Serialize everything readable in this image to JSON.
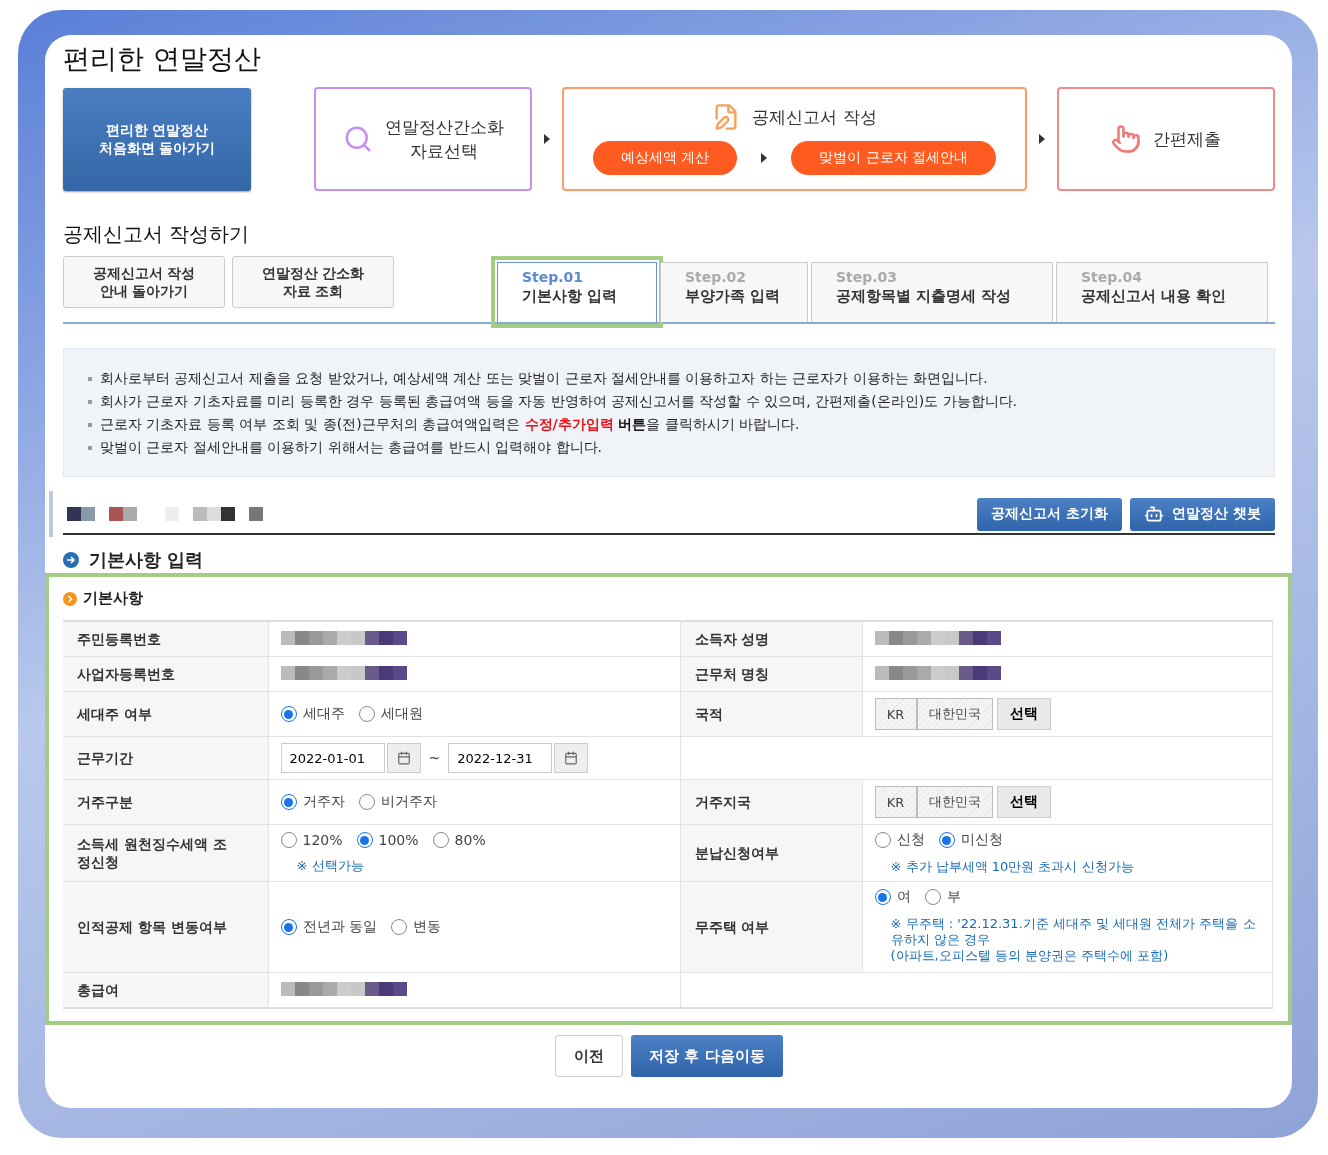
{
  "title": "편리한 연말정산",
  "flow": {
    "home_button": {
      "lines": [
        "편리한 연말정산",
        "처음화면 돌아가기"
      ]
    },
    "stages": [
      {
        "kind": "select",
        "lines": [
          "연말정산간소화",
          "자료선택"
        ]
      },
      {
        "kind": "write",
        "title": "공제신고서 작성",
        "pills": [
          "예상세액 계산",
          "맞벌이 근로자 절세안내"
        ]
      },
      {
        "kind": "submit",
        "lines": [
          "간편제출"
        ]
      }
    ]
  },
  "section_title": "공제신고서 작성하기",
  "side_buttons": [
    {
      "lines": [
        "공제신고서 작성",
        "안내 돌아가기"
      ]
    },
    {
      "lines": [
        "연말정산 간소화",
        "자료 조회"
      ]
    }
  ],
  "steps": [
    {
      "step": "Step.01",
      "label": "기본사항 입력",
      "selected": true,
      "highlighted": true
    },
    {
      "step": "Step.02",
      "label": "부양가족 입력",
      "selected": false,
      "highlighted": false
    },
    {
      "step": "Step.03",
      "label": "공제항목별 지출명세 작성",
      "selected": false,
      "highlighted": false
    },
    {
      "step": "Step.04",
      "label": "공제신고서 내용 확인",
      "selected": false,
      "highlighted": false
    }
  ],
  "notices": [
    "회사로부터 공제신고서 제출을 요청 받았거나, 예상세액 계산 또는 맞벌이 근로자 절세안내를 이용하고자 하는 근로자가 이용하는 화면입니다.",
    "회사가 근로자 기초자료를 미리 등록한 경우 등록된 총급여액 등을 자동 반영하여 공제신고서를 작성할 수 있으며, 간편제출(온라인)도 가능합니다.",
    "근로자 기초자료 등록 여부 조회 및 종(전)근무처의 총급여액입력은 **수정/추가입력** **버튼**을 클릭하시기 바랍니다.",
    "맞벌이 근로자 절세안내를 이용하기 위해서는 총급여를 반드시 입력해야 합니다."
  ],
  "toolbar_buttons": [
    {
      "kind": "plain",
      "label": "공제신고서 초기화"
    },
    {
      "kind": "chatbot",
      "label": "연말정산 챗봇"
    }
  ],
  "subheading": "기본사항 입력",
  "form": {
    "title": "기본사항",
    "highlighted": true,
    "rows": [
      {
        "cells": [
          {
            "label": "주민등록번호",
            "field": {
              "kind": "redacted"
            }
          },
          {
            "label": "소득자 성명",
            "field": {
              "kind": "redacted"
            }
          }
        ]
      },
      {
        "cells": [
          {
            "label": "사업자등록번호",
            "field": {
              "kind": "redacted"
            }
          },
          {
            "label": "근무처 명칭",
            "field": {
              "kind": "redacted"
            }
          }
        ]
      },
      {
        "cells": [
          {
            "label": "세대주 여부",
            "field": {
              "kind": "radio",
              "options": [
                {
                  "label": "세대주",
                  "selected": true
                },
                {
                  "label": "세대원",
                  "selected": false
                }
              ]
            }
          },
          {
            "label": "국적",
            "field": {
              "kind": "country",
              "code": "KR",
              "name": "대한민국",
              "button": "선택"
            }
          }
        ]
      },
      {
        "cells": [
          {
            "label": "근무기간",
            "field": {
              "kind": "daterange",
              "from": "2022-01-01",
              "separator": "~",
              "to": "2022-12-31"
            }
          }
        ]
      },
      {
        "cells": [
          {
            "label": "거주구분",
            "field": {
              "kind": "radio",
              "options": [
                {
                  "label": "거주자",
                  "selected": true
                },
                {
                  "label": "비거주자",
                  "selected": false
                }
              ]
            }
          },
          {
            "label": "거주지국",
            "field": {
              "kind": "country",
              "code": "KR",
              "name": "대한민국",
              "button": "선택"
            }
          }
        ]
      },
      {
        "cells": [
          {
            "label": "소득세 원천징수세액 조정신청",
            "field": {
              "kind": "radio",
              "options": [
                {
                  "label": "120%",
                  "selected": false
                },
                {
                  "label": "100%",
                  "selected": true
                },
                {
                  "label": "80%",
                  "selected": false
                }
              ],
              "note": "※ 선택가능"
            }
          },
          {
            "label": "분납신청여부",
            "field": {
              "kind": "radio",
              "options": [
                {
                  "label": "신청",
                  "selected": false
                },
                {
                  "label": "미신청",
                  "selected": true
                }
              ],
              "note": "※ 추가 납부세액 10만원 초과시 신청가능"
            }
          }
        ]
      },
      {
        "cells": [
          {
            "label": "인적공제 항목 변동여부",
            "field": {
              "kind": "radio",
              "options": [
                {
                  "label": "전년과 동일",
                  "selected": true
                },
                {
                  "label": "변동",
                  "selected": false
                }
              ]
            }
          },
          {
            "label": "무주택 여부",
            "field": {
              "kind": "radio",
              "options": [
                {
                  "label": "여",
                  "selected": true
                },
                {
                  "label": "부",
                  "selected": false
                }
              ],
              "note": "※ 무주택 : '22.12.31.기준 세대주 및 세대원 전체가 주택을 소유하지 않은 경우",
              "note_extra": "(아파트,오피스텔 등의 분양권은 주택수에 포함)"
            }
          }
        ]
      },
      {
        "cells": [
          {
            "label": "총급여",
            "field": {
              "kind": "redacted"
            }
          }
        ]
      }
    ]
  },
  "footer_buttons": [
    {
      "kind": "secondary",
      "label": "이전"
    },
    {
      "kind": "primary",
      "label": "저장 후 다음이동"
    }
  ]
}
